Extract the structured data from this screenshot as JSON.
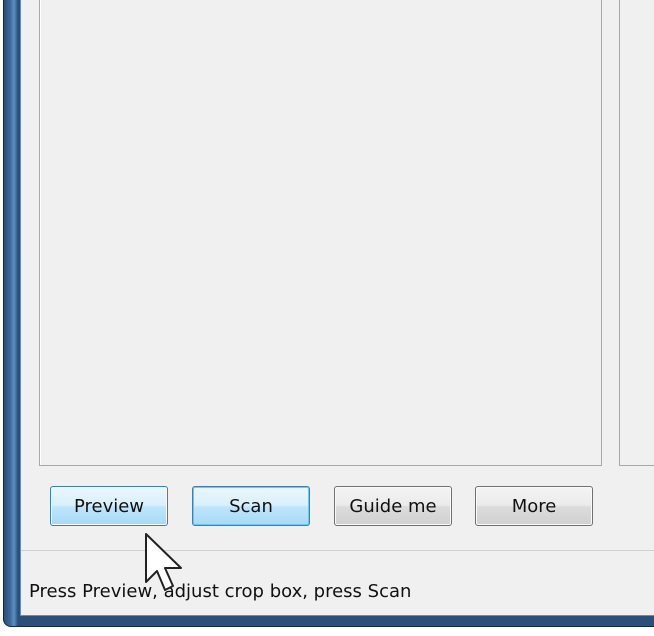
{
  "buttons": {
    "preview_label": "Preview",
    "scan_label": "Scan",
    "guide_label": "Guide me",
    "more_label": "More"
  },
  "status": {
    "text": "Press Preview, adjust crop box, press Scan"
  },
  "colors": {
    "window_frame": "#3a6a9c",
    "client_bg": "#f0f0f0",
    "button_highlight_border": "#3c7fb1"
  },
  "icons": {
    "cursor": "arrow-cursor-icon"
  }
}
